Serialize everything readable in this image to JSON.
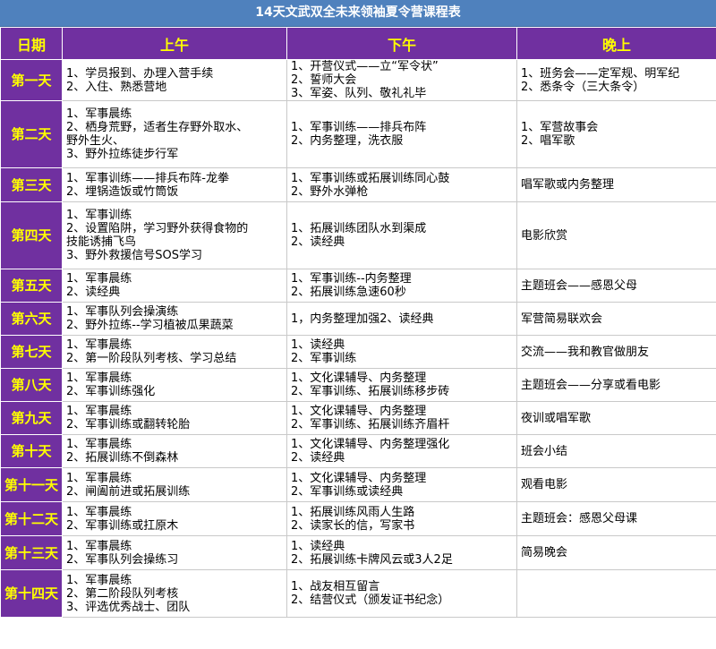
{
  "title": "14天文武双全未来领袖夏令营课程表",
  "headers": [
    "日期",
    "上午",
    "下午",
    "晚上"
  ],
  "rows": [
    {
      "day": "第一天",
      "am": [
        "1、学员报到、办理入营手续",
        "2、入住、熟悉营地"
      ],
      "pm": [
        "1、开营仪式——立“军令状”",
        "2、誓师大会",
        "3、军姿、队列、敬礼礼毕"
      ],
      "eve": [
        "1、班务会——定军规、明军纪",
        "2、悉条令（三大条令）"
      ]
    },
    {
      "day": "第二天",
      "am": [
        "1、军事晨练",
        "2、栖身荒野，适者生存野外取水、",
        "野外生火、",
        "3、野外拉练徒步行军"
      ],
      "pm": [
        "1、军事训练——排兵布阵",
        "2、内务整理，洗衣服"
      ],
      "eve": [
        "1、军营故事会",
        "2、唱军歌"
      ]
    },
    {
      "day": "第三天",
      "am": [
        "1、军事训练——排兵布阵-龙拳",
        "2、埋锅造饭或竹筒饭"
      ],
      "pm": [
        "1、军事训练或拓展训练同心鼓",
        "2、野外水弹枪"
      ],
      "eve": [
        "唱军歌或内务整理"
      ]
    },
    {
      "day": "第四天",
      "am": [
        "1、军事训练",
        "2、设置陷阱，学习野外获得食物的",
        "技能诱捕飞鸟",
        "3、野外救援信号SOS学习"
      ],
      "pm": [
        "1、拓展训练团队水到渠成",
        "2、读经典"
      ],
      "eve": [
        "电影欣赏"
      ]
    },
    {
      "day": "第五天",
      "am": [
        "1、军事晨练",
        "2、读经典"
      ],
      "pm": [
        "1、军事训练--内务整理",
        "2、拓展训练急速60秒"
      ],
      "eve": [
        "主题班会——感恩父母"
      ]
    },
    {
      "day": "第六天",
      "am": [
        "1、军事队列会操演练",
        "2、野外拉练--学习植被瓜果蔬菜"
      ],
      "pm": [
        "1，内务整理加强2、读经典"
      ],
      "eve": [
        "军营简易联欢会"
      ]
    },
    {
      "day": "第七天",
      "am": [
        "1、军事晨练",
        "2、第一阶段队列考核、学习总结"
      ],
      "pm": [
        "1、读经典",
        "2、军事训练"
      ],
      "eve": [
        "交流——我和教官做朋友"
      ]
    },
    {
      "day": "第八天",
      "am": [
        "1、军事晨练",
        "2、军事训练强化"
      ],
      "pm": [
        "1、文化课辅导、内务整理",
        "2、军事训练、拓展训练移步砖"
      ],
      "eve": [
        "主题班会——分享或看电影"
      ]
    },
    {
      "day": "第九天",
      "am": [
        "1、军事晨练",
        "2、军事训练或翻转轮胎"
      ],
      "pm": [
        "1、文化课辅导、内务整理",
        "2、军事训练、拓展训练齐眉杆"
      ],
      "eve": [
        "夜训或唱军歌"
      ]
    },
    {
      "day": "第十天",
      "am": [
        "1、军事晨练",
        "2、拓展训练不倒森林"
      ],
      "pm": [
        "1、文化课辅导、内务整理强化",
        "2、读经典"
      ],
      "eve": [
        " 班会小结"
      ]
    },
    {
      "day": "第十一天",
      "am": [
        "1、军事晨练",
        "2、闸阖前进或拓展训练"
      ],
      "pm": [
        "1、文化课辅导、内务整理",
        "2、军事训练或读经典"
      ],
      "eve": [
        "观看电影"
      ]
    },
    {
      "day": "第十二天",
      "am": [
        "1、军事晨练",
        "2、军事训练或扛原木"
      ],
      "pm": [
        "1、拓展训练风雨人生路",
        "2、读家长的信，写家书"
      ],
      "eve": [
        " 主题班会：感恩父母课"
      ]
    },
    {
      "day": "第十三天",
      "am": [
        "1、军事晨练",
        "2、军事队列会操练习"
      ],
      "pm": [
        "1、读经典",
        "2、拓展训练卡牌风云或3人2足"
      ],
      "eve": [
        "简易晚会"
      ]
    },
    {
      "day": "第十四天",
      "am": [
        "1、军事晨练",
        "2、第二阶段队列考核",
        "3、评选优秀战士、团队"
      ],
      "pm": [
        "1、战友相互留言",
        "2、结营仪式（颁发证书纪念）"
      ],
      "eve": [
        ""
      ]
    }
  ]
}
